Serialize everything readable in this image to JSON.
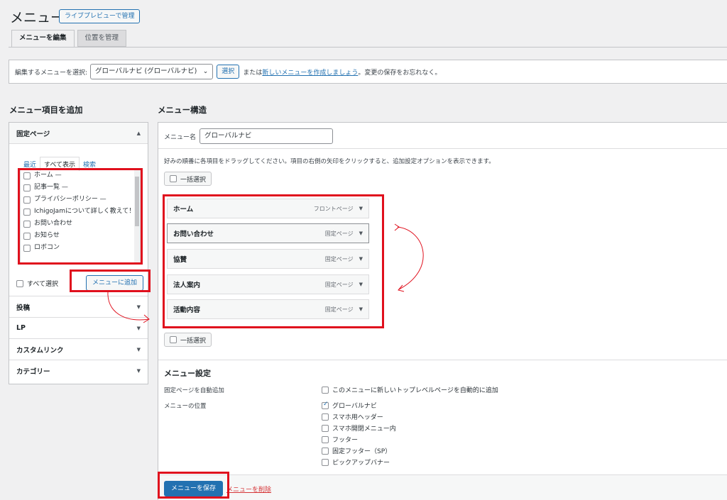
{
  "page": {
    "title": "メニュー",
    "live_preview_button": "ライブプレビューで管理"
  },
  "tabs": [
    {
      "label": "メニューを編集",
      "active": true
    },
    {
      "label": "位置を管理",
      "active": false
    }
  ],
  "select_bar": {
    "label": "編集するメニューを選択:",
    "selected_menu": "グローバルナビ (グローバルナビ)",
    "select_button": "選択",
    "or_text": "または",
    "create_link": "新しいメニューを作成しましょう",
    "save_note": "。変更の保存をお忘れなく。"
  },
  "left": {
    "heading": "メニュー項目を追加",
    "sections": [
      {
        "label": "固定ページ",
        "expanded": true
      },
      {
        "label": "投稿"
      },
      {
        "label": "LP"
      },
      {
        "label": "カスタムリンク"
      },
      {
        "label": "カテゴリー"
      }
    ],
    "subtabs": [
      {
        "label": "最近"
      },
      {
        "label": "すべて表示",
        "active": true
      },
      {
        "label": "検索"
      }
    ],
    "pages": [
      "ホーム —",
      "記事一覧 —",
      "プライバシーポリシー —",
      "IchigoJamについて詳しく教えて！",
      "お問い合わせ",
      "お知らせ",
      "ロボコン"
    ],
    "select_all": "すべて選択",
    "add_button": "メニューに追加"
  },
  "right": {
    "heading": "メニュー構造",
    "name_label": "メニュー名",
    "name_value": "グローバルナビ",
    "instruction": "好みの順番に各項目をドラッグしてください。項目の右側の矢印をクリックすると、追加設定オプションを表示できます。",
    "bulk_select": "一括選択",
    "items": [
      {
        "title": "ホーム",
        "type": "フロントページ"
      },
      {
        "title": "お問い合わせ",
        "type": "固定ページ"
      },
      {
        "title": "協賛",
        "type": "固定ページ"
      },
      {
        "title": "法人案内",
        "type": "固定ページ"
      },
      {
        "title": "活動内容",
        "type": "固定ページ"
      }
    ],
    "settings": {
      "title": "メニュー設定",
      "auto_add_label": "固定ページを自動追加",
      "auto_add_option": "このメニューに新しいトップレベルページを自動的に追加",
      "location_label": "メニューの位置",
      "locations": [
        {
          "label": "グローバルナビ",
          "checked": true
        },
        {
          "label": "スマホ用ヘッダー",
          "checked": false
        },
        {
          "label": "スマホ開閉メニュー内",
          "checked": false
        },
        {
          "label": "フッター",
          "checked": false
        },
        {
          "label": "固定フッター（SP）",
          "checked": false
        },
        {
          "label": "ピックアップバナー",
          "checked": false
        }
      ]
    },
    "save_button": "メニューを保存",
    "delete_link": "メニューを削除"
  },
  "colors": {
    "accent": "#2271b1",
    "highlight": "#e0101d",
    "delete": "#d63638"
  }
}
